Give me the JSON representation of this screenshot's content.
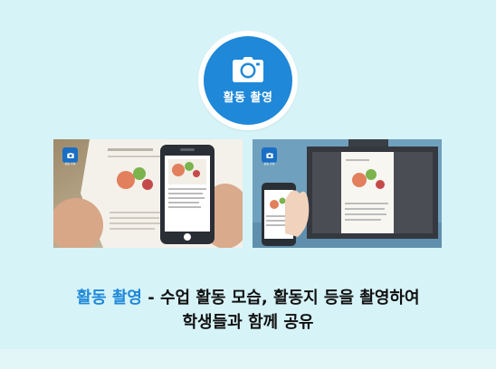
{
  "activity": {
    "icon": "camera-icon",
    "title": "활동 촬영"
  },
  "panels": [
    {
      "name": "photo-teacher-phone",
      "mini_badge_icon": "camera-icon",
      "mini_badge_label": "활동 촬영"
    },
    {
      "name": "photo-share-screen",
      "mini_badge_icon": "camera-icon",
      "mini_badge_label": "활동 촬영"
    }
  ],
  "caption": {
    "highlight": "활동 촬영",
    "line1_rest": " - 수업 활동 모습, 활동지 등을 촬영하여",
    "line2": "학생들과 함께 공유"
  },
  "colors": {
    "background": "#d6f3f7",
    "accent": "#1f88d8",
    "text": "#111111"
  }
}
